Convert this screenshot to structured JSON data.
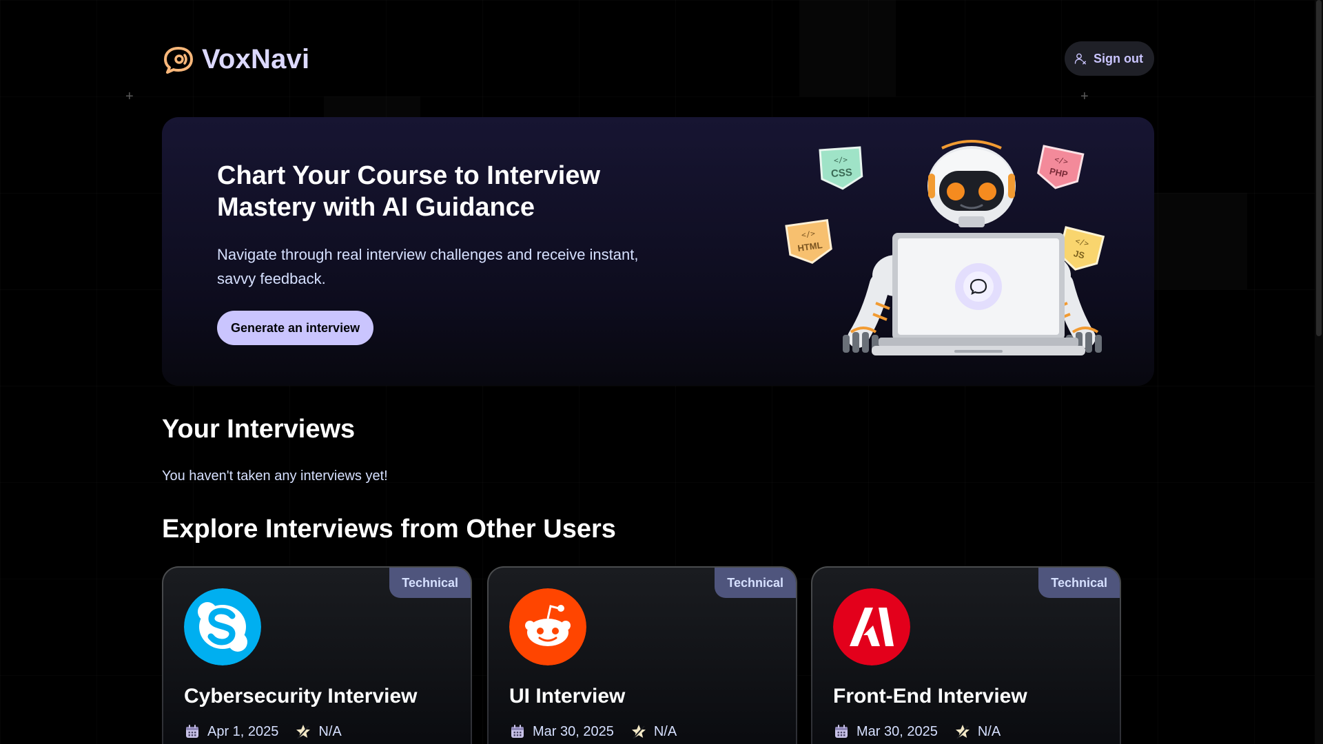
{
  "app": {
    "name": "VoxNavi",
    "signout_label": "Sign out"
  },
  "hero": {
    "title": "Chart Your Course to Interview Mastery with AI Guidance",
    "subtitle": "Navigate through real interview challenges and receive instant, savvy feedback.",
    "cta_label": "Generate an interview",
    "tech_tags": [
      "CSS",
      "PHP",
      "HTML",
      "JS"
    ]
  },
  "your_interviews": {
    "title": "Your Interviews",
    "empty_message": "You haven't taken any interviews yet!"
  },
  "explore": {
    "title": "Explore Interviews from Other Users",
    "cards": [
      {
        "badge": "Technical",
        "title": "Cybersecurity Interview",
        "date": "Apr 1, 2025",
        "score": "N/A",
        "logo": "skype-logo",
        "logo_color": "#00aff0"
      },
      {
        "badge": "Technical",
        "title": "UI Interview",
        "date": "Mar 30, 2025",
        "score": "N/A",
        "logo": "reddit-logo",
        "logo_color": "#ff4500"
      },
      {
        "badge": "Technical",
        "title": "Front-End Interview",
        "date": "Mar 30, 2025",
        "score": "N/A",
        "logo": "adobe-logo",
        "logo_color": "#e3001b"
      }
    ]
  },
  "colors": {
    "accent": "#cac5fe",
    "badge": "#4f557d",
    "logo_orange": "#f9b77a"
  }
}
